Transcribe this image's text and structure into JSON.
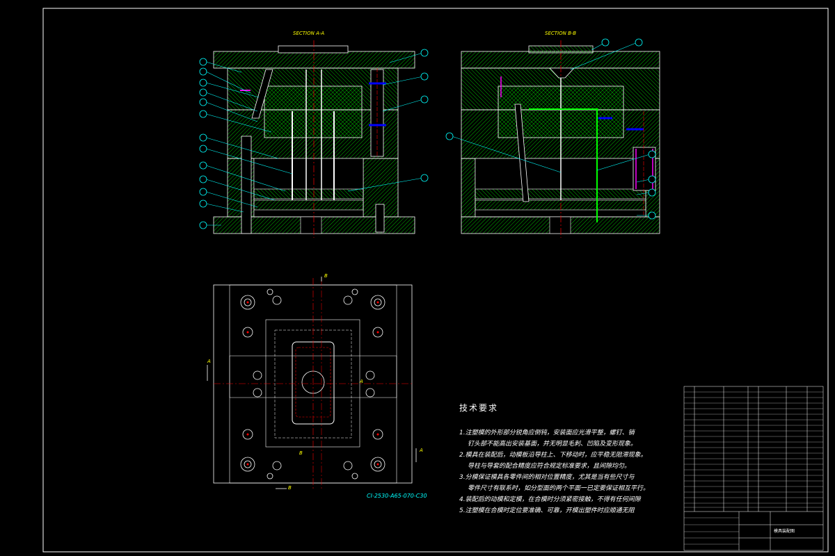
{
  "drawing": {
    "section_a_title": "SECTION A-A",
    "section_b_title": "SECTION B-B",
    "model_code": "CI-2530-A65-070-C30",
    "plan_section_marks": [
      "B",
      "B",
      "A",
      "A",
      "B",
      "A"
    ]
  },
  "tech_requirements": {
    "title": "技术要求",
    "items": [
      "1.注塑模的外形部分锐角应倒钝，安装面应光滑平整，螺钉、销",
      "钉头部不能高出安装基面，并无明显毛刺、凹陷及变形现象。",
      "2.模具在装配后，动模板沿导柱上、下移动时，应平稳无阻滞现象。",
      "导柱与导套的配合精度应符合规定标准要求，且间隙均匀。",
      "3.分模保证模具各零件间的相对位置精度，尤其是当有些尺寸与",
      "零件尺寸有联系时，如分型面的两个平面一已定要保证相互平行。",
      "4.装配后的动模和定模，在合模时分须紧密接触，不得有任何间隙",
      "5.注塑模在合模时定位要准确、可靠，开模出塑件时应顺通无阻"
    ]
  },
  "title_block": {
    "drawing_name": "模具装配图"
  },
  "colors": {
    "background": "#000000",
    "hatch": "#00cc00",
    "outline": "#ffffff",
    "label": "#ffff00",
    "leader": "#00ffff",
    "centerline": "#ff0000",
    "part_magenta": "#ff00ff",
    "part_blue": "#0000ff"
  }
}
